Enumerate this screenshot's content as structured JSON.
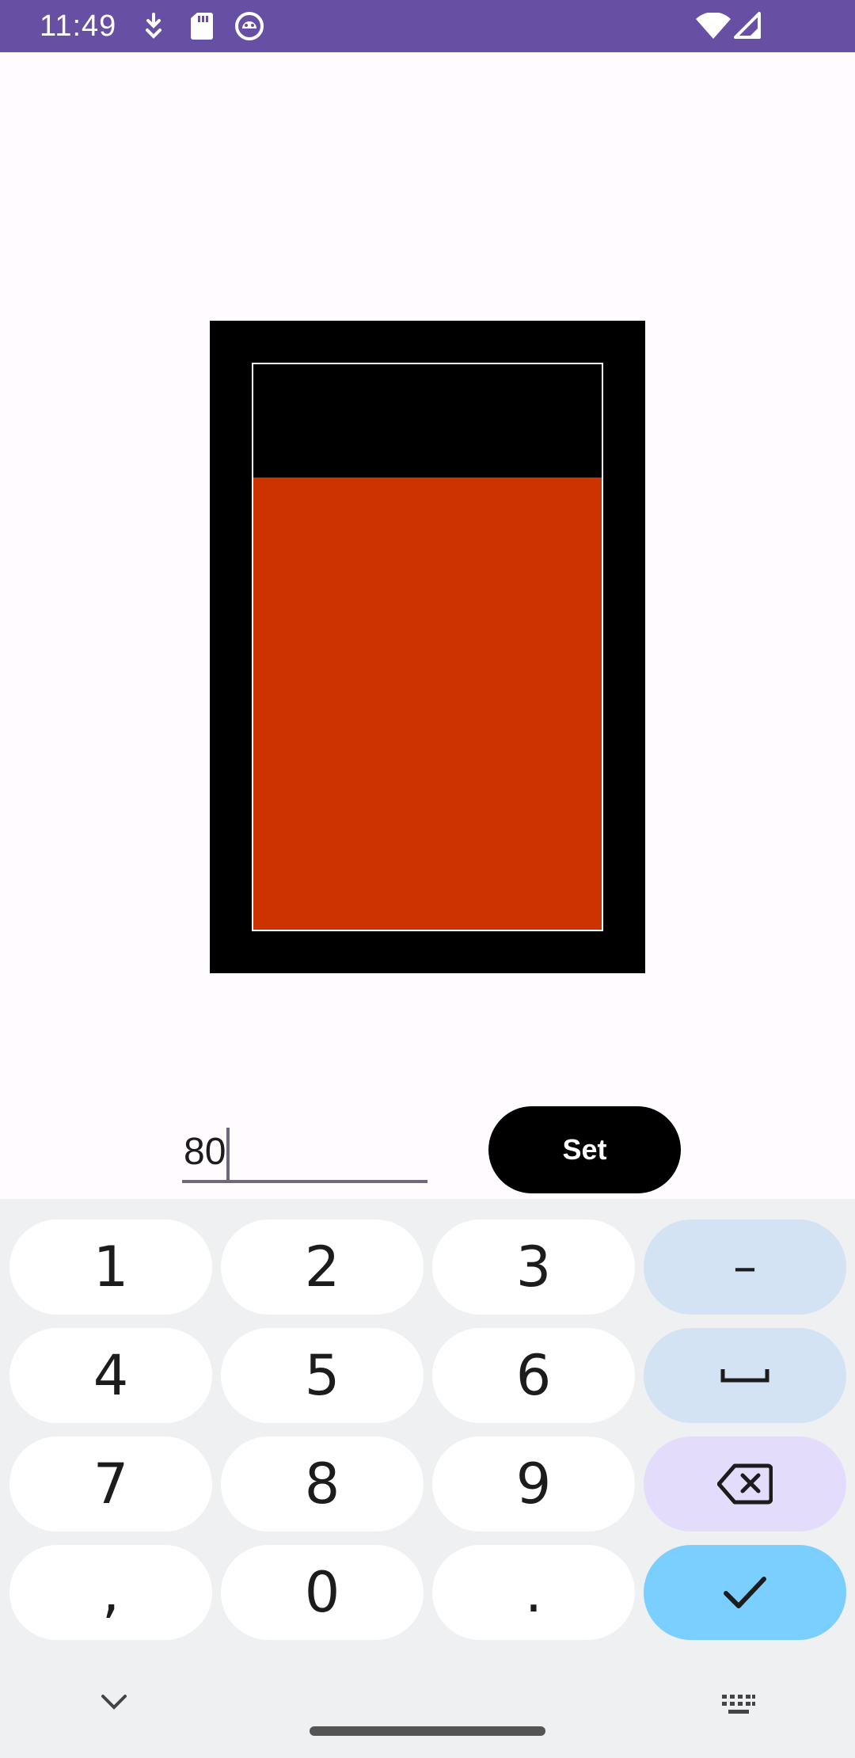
{
  "status_bar": {
    "time": "11:49",
    "icons": [
      "download-icon",
      "sd-card-icon",
      "debug-icon",
      "wifi-icon",
      "signal-icon"
    ],
    "color": "#6750a4"
  },
  "gauge": {
    "level_percent": 80,
    "fill_color": "#cc3300",
    "frame_color": "#000000"
  },
  "input": {
    "value": "80"
  },
  "set_button": {
    "label": "Set"
  },
  "keyboard": {
    "rows": [
      [
        "1",
        "2",
        "3",
        "–"
      ],
      [
        "4",
        "5",
        "6",
        "space"
      ],
      [
        "7",
        "8",
        "9",
        "backspace"
      ],
      [
        ",",
        "0",
        ".",
        "enter"
      ]
    ],
    "labels": {
      "k1": "1",
      "k2": "2",
      "k3": "3",
      "k4": "4",
      "k5": "5",
      "k6": "6",
      "k7": "7",
      "k8": "8",
      "k9": "9",
      "comma": ",",
      "k0": "0",
      "period": ".",
      "minus": "–"
    },
    "bottom_icons": [
      "chevron-down-icon",
      "keyboard-icon"
    ]
  }
}
